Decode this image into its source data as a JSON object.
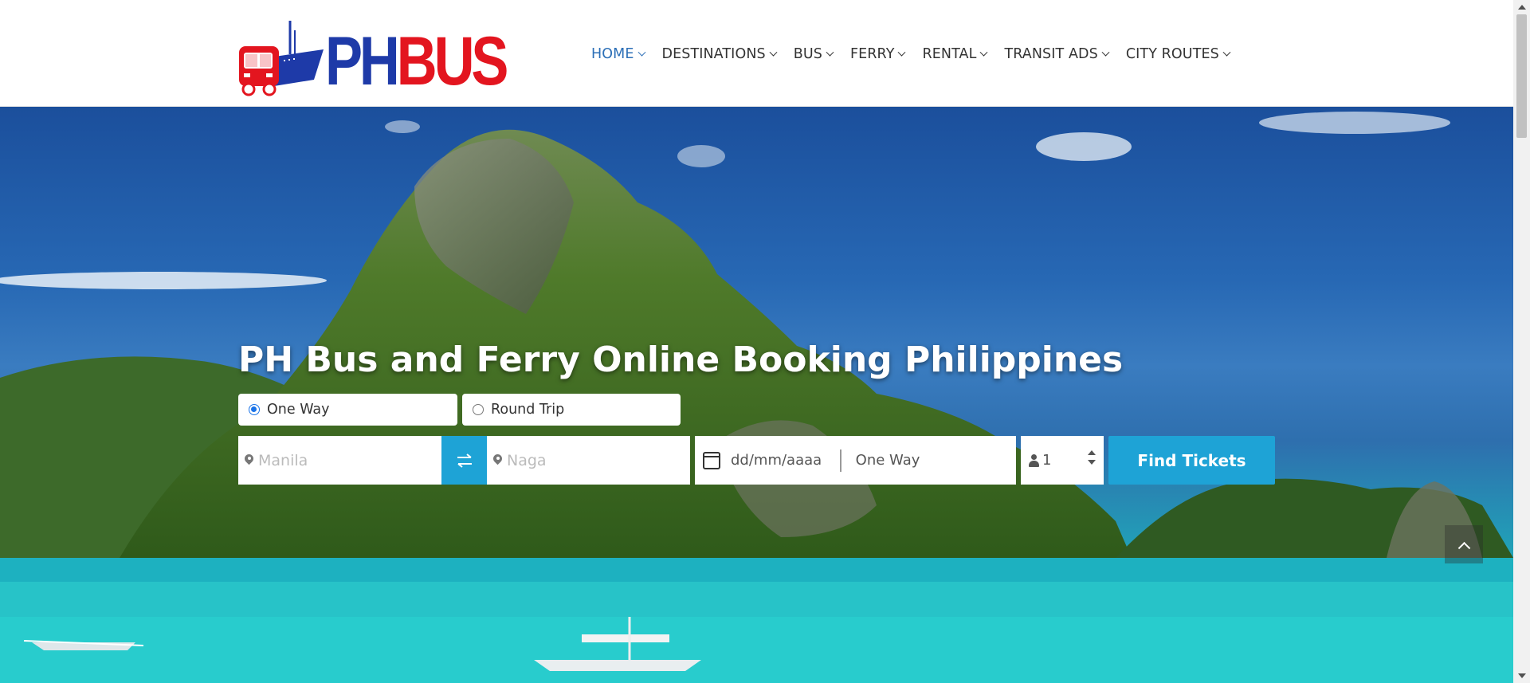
{
  "brand": {
    "logo_text_1": "PH",
    "logo_text_2": "BUS",
    "colors": {
      "ph": "#1e3aa8",
      "bus": "#e3151f"
    }
  },
  "nav": {
    "items": [
      {
        "label": "HOME",
        "active": true
      },
      {
        "label": "DESTINATIONS",
        "active": false
      },
      {
        "label": "BUS",
        "active": false
      },
      {
        "label": "FERRY",
        "active": false
      },
      {
        "label": "RENTAL",
        "active": false
      },
      {
        "label": "TRANSIT ADS",
        "active": false
      },
      {
        "label": "CITY ROUTES",
        "active": false
      }
    ]
  },
  "hero": {
    "title": "PH Bus and Ferry Online Booking Philippines"
  },
  "booking": {
    "trip_type": {
      "one_way_label": "One Way",
      "round_trip_label": "Round Trip",
      "selected": "One Way"
    },
    "origin_placeholder": "Manila",
    "destination_placeholder": "Naga",
    "date_placeholder": "dd/mm/aaaa",
    "return_label": "One Way",
    "passengers": "1",
    "submit_label": "Find Tickets"
  },
  "icons": {
    "swap": "swap-arrows-icon",
    "pin": "map-pin-icon",
    "calendar": "calendar-icon",
    "person": "person-icon",
    "back_to_top": "chevron-up-icon"
  },
  "accent": "#1ea3d6"
}
